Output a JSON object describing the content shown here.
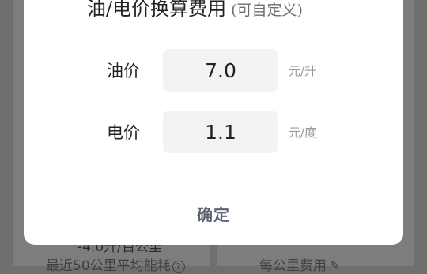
{
  "background": {
    "average_value": "-4.0升/百公里",
    "average_caption": "最近50公里平均能耗",
    "help_icon": "question-circle-icon",
    "per_km_caption": "每公里费用",
    "edit_icon": "pencil-icon"
  },
  "dialog": {
    "title": "油/电价换算费用",
    "subtitle": "(可自定义)",
    "oil": {
      "label": "油价",
      "value": "7.0",
      "unit": "元/升"
    },
    "electric": {
      "label": "电价",
      "value": "1.1",
      "unit": "元/度"
    },
    "confirm_label": "确定"
  }
}
